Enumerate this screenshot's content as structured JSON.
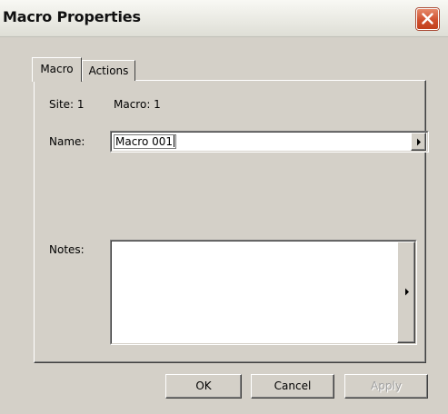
{
  "window": {
    "title": "Macro Properties"
  },
  "tabs": [
    {
      "label": "Macro",
      "selected": true
    },
    {
      "label": "Actions",
      "selected": false
    }
  ],
  "macro_tab": {
    "site_text": "Site: 1",
    "macro_text": "Macro: 1",
    "name_label": "Name:",
    "name_value": "Macro 001",
    "notes_label": "Notes:",
    "notes_value": ""
  },
  "buttons": {
    "ok": "OK",
    "cancel": "Cancel",
    "apply": "Apply",
    "apply_enabled": false
  },
  "colors": {
    "dialog_bg": "#d4d0c8",
    "close_button": "#d0502e"
  },
  "icons": {
    "close": "close-x-icon",
    "expand": "arrow-right-icon"
  }
}
